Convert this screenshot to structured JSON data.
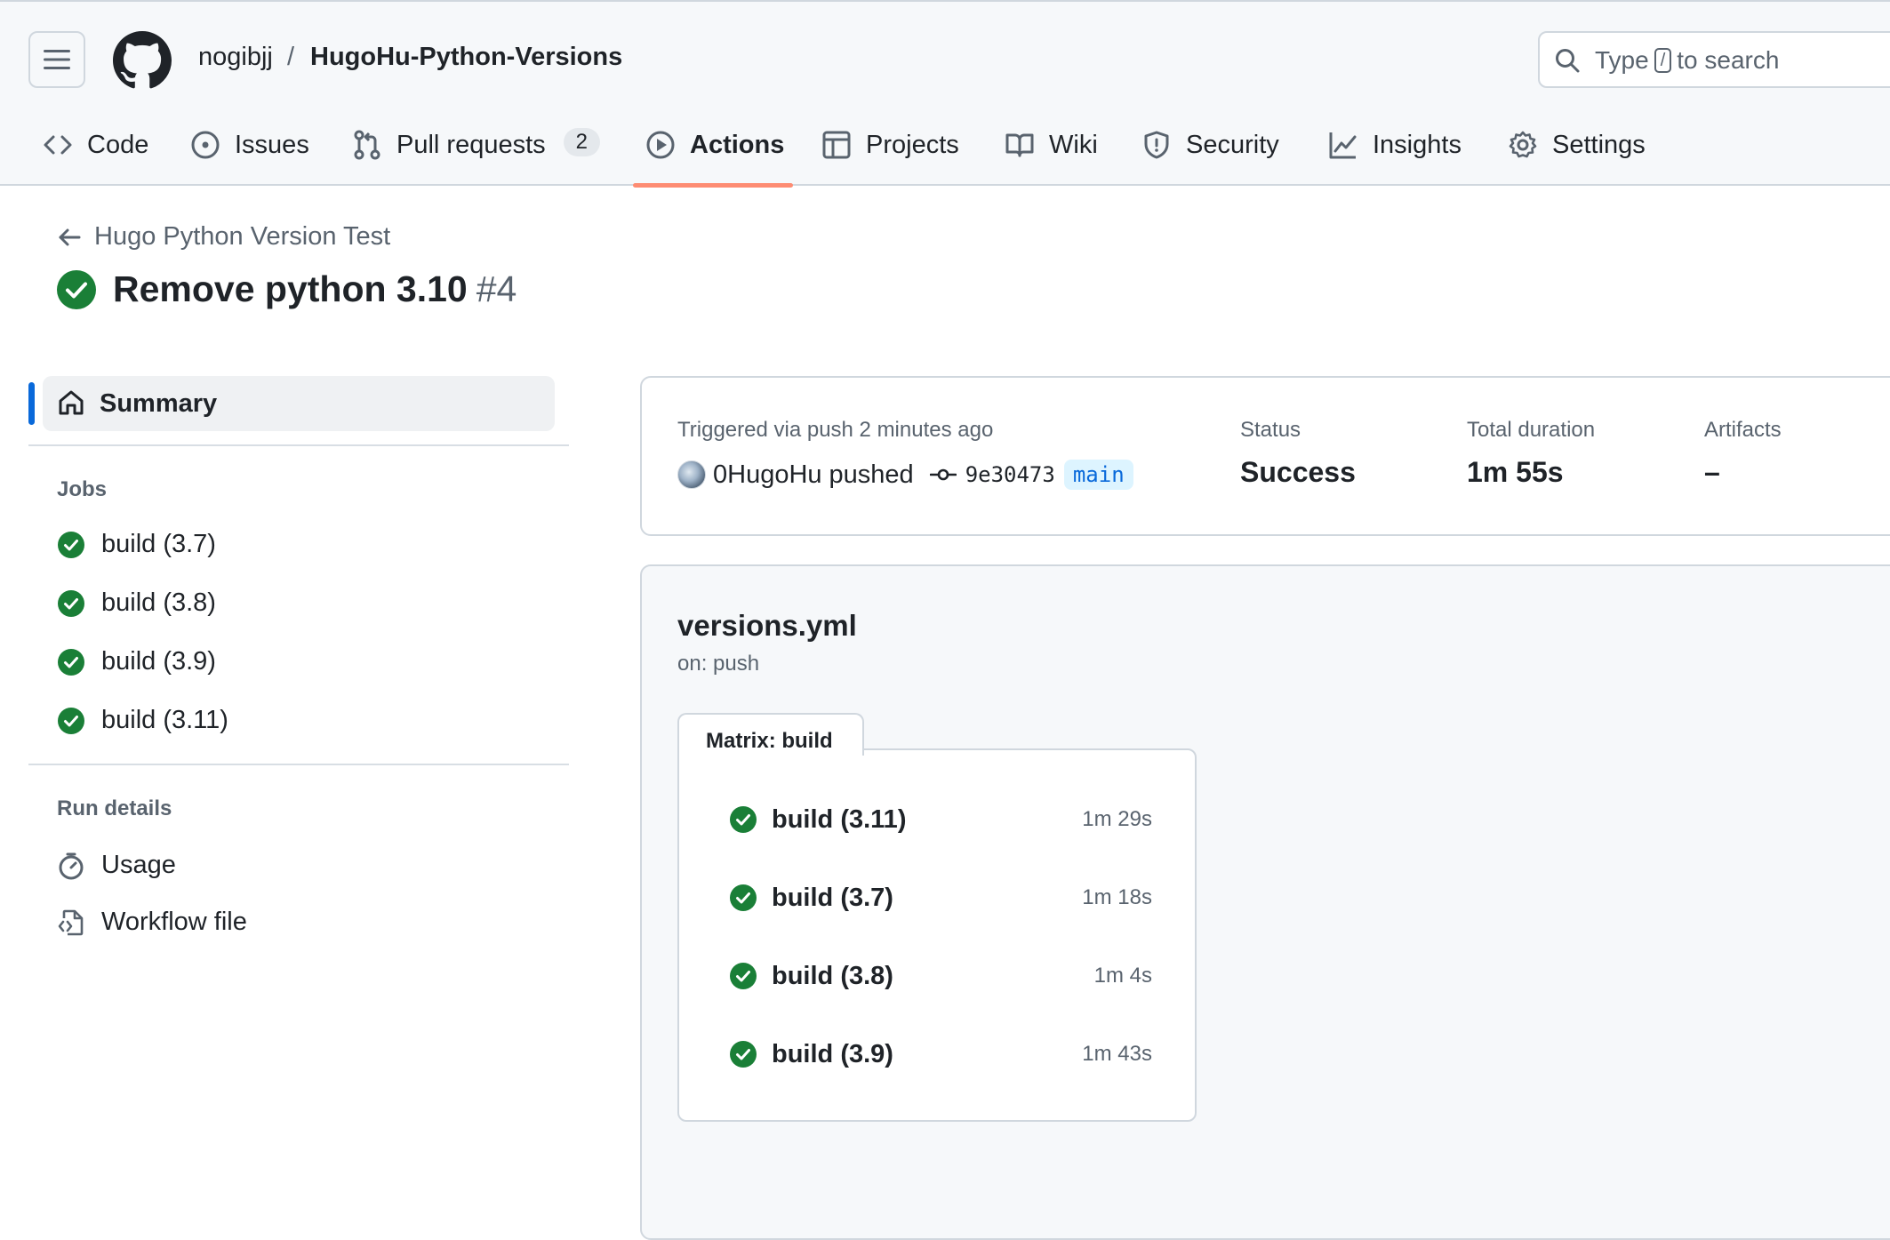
{
  "header": {
    "owner": "nogibjj",
    "separator": "/",
    "repo": "HugoHu-Python-Versions",
    "search": {
      "prefix": "Type",
      "key": "/",
      "suffix": "to search"
    }
  },
  "tabs": [
    {
      "label": "Code",
      "icon": "code-icon"
    },
    {
      "label": "Issues",
      "icon": "issue-opened-icon"
    },
    {
      "label": "Pull requests",
      "icon": "git-pull-request-icon",
      "count": "2"
    },
    {
      "label": "Actions",
      "icon": "play-icon",
      "active": true
    },
    {
      "label": "Projects",
      "icon": "table-icon"
    },
    {
      "label": "Wiki",
      "icon": "book-icon"
    },
    {
      "label": "Security",
      "icon": "shield-icon"
    },
    {
      "label": "Insights",
      "icon": "graph-icon"
    },
    {
      "label": "Settings",
      "icon": "gear-icon"
    }
  ],
  "run": {
    "workflow_link": "Hugo Python Version Test",
    "title": "Remove python 3.10",
    "number": "#4",
    "status_color": "#1a7f37"
  },
  "sidebar": {
    "summary_label": "Summary",
    "jobs_heading": "Jobs",
    "jobs": [
      "build (3.7)",
      "build (3.8)",
      "build (3.9)",
      "build (3.11)"
    ],
    "run_details_heading": "Run details",
    "details": [
      {
        "label": "Usage",
        "icon": "stopwatch-icon"
      },
      {
        "label": "Workflow file",
        "icon": "file-code-icon"
      }
    ]
  },
  "summary": {
    "trigger_text": "Triggered via push 2 minutes ago",
    "actor": "0HugoHu",
    "action": "pushed",
    "sha": "9e30473",
    "branch": "main",
    "status_label": "Status",
    "status_value": "Success",
    "duration_label": "Total duration",
    "duration_value": "1m 55s",
    "artifacts_label": "Artifacts",
    "artifacts_value": "–"
  },
  "workflow": {
    "file": "versions.yml",
    "trigger": "on: push",
    "matrix_label": "Matrix: build",
    "matrix_jobs": [
      {
        "name": "build (3.11)",
        "duration": "1m 29s"
      },
      {
        "name": "build (3.7)",
        "duration": "1m 18s"
      },
      {
        "name": "build (3.8)",
        "duration": "1m 4s"
      },
      {
        "name": "build (3.9)",
        "duration": "1m 43s"
      }
    ]
  }
}
